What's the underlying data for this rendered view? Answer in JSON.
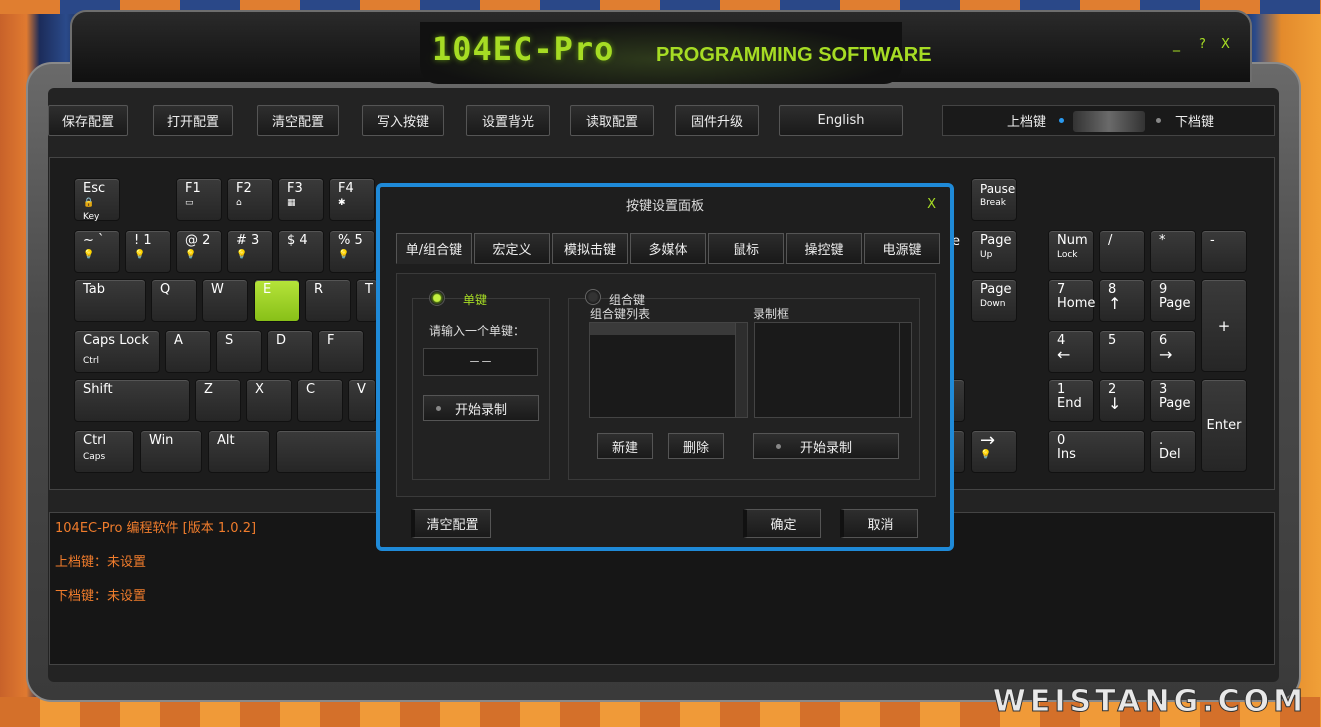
{
  "title": {
    "main": "104EC-Pro",
    "sub": "PROGRAMMING SOFTWARE"
  },
  "window_controls": {
    "minimize": "_",
    "help": "?",
    "close": "X"
  },
  "toolbar": {
    "buttons": [
      "保存配置",
      "打开配置",
      "清空配置",
      "写入按键",
      "设置背光",
      "读取配置",
      "固件升级",
      "English"
    ]
  },
  "layer": {
    "upper": "上档键",
    "lower": "下档键"
  },
  "keys": {
    "esc": "Esc",
    "esc_sub": "Key",
    "f1": "F1",
    "f2": "F2",
    "f3": "F3",
    "f4": "F4",
    "pause": "Pause",
    "pause_sub": "Break",
    "tilde": "~  `",
    "k1": "!   1",
    "k2": "@  2",
    "k3": "#   3",
    "k4": "$   4",
    "k5": "%   5",
    "tab": "Tab",
    "q": "Q",
    "w": "W",
    "e": "E",
    "r": "R",
    "t": "T",
    "caps": "Caps Lock",
    "caps_sub": "Ctrl",
    "a": "A",
    "s": "S",
    "d": "D",
    "f": "F",
    "shift": "Shift",
    "z": "Z",
    "x": "X",
    "c": "C",
    "v": "V",
    "ctrl": "Ctrl",
    "ctrl_sub": "Caps",
    "win": "Win",
    "alt": "Alt",
    "pgup": "Page",
    "pgup_sub": "Up",
    "pgdn": "Page",
    "pgdn_sub": "Down",
    "e_edge": "e",
    "numlock": "Num",
    "numlock_sub": "Lock",
    "slash": "/",
    "star": "*",
    "minus": "-",
    "n7": "7",
    "n7_sub": "Home",
    "n8": "8",
    "n9": "9",
    "n9_sub": "Page",
    "plus": "+",
    "n4": "4",
    "n5": "5",
    "n6": "6",
    "n1": "1",
    "n1_sub": "End",
    "n2": "2",
    "n3": "3",
    "n3_sub": "Page",
    "enter": "Enter",
    "n0": "0",
    "n0_sub": "Ins",
    "dot": ".",
    "dot_sub": "Del",
    "right_arrow": "→"
  },
  "log": {
    "lines": [
      "104EC-Pro 编程软件 [版本 1.0.2]",
      "上档键：未设置",
      "下档键：未设置"
    ]
  },
  "dialog": {
    "title": "按键设置面板",
    "close": "X",
    "tabs": [
      "单/组合键",
      "宏定义",
      "模拟击键",
      "多媒体",
      "鼠标",
      "操控键",
      "电源键"
    ],
    "single": {
      "label": "单键",
      "prompt": "请输入一个单键：",
      "value": "－－",
      "record": "开始录制"
    },
    "combo": {
      "label": "组合键",
      "list_label": "组合键列表",
      "record_label": "录制框",
      "new": "新建",
      "delete": "删除",
      "record": "开始录制"
    },
    "clear": "清空配置",
    "ok": "确定",
    "cancel": "取消"
  },
  "watermark": "WEISTANG.COM",
  "colors": {
    "accent": "#a6dc24",
    "dialog_border": "#1f8ad8",
    "log_text": "#f07c2c"
  }
}
